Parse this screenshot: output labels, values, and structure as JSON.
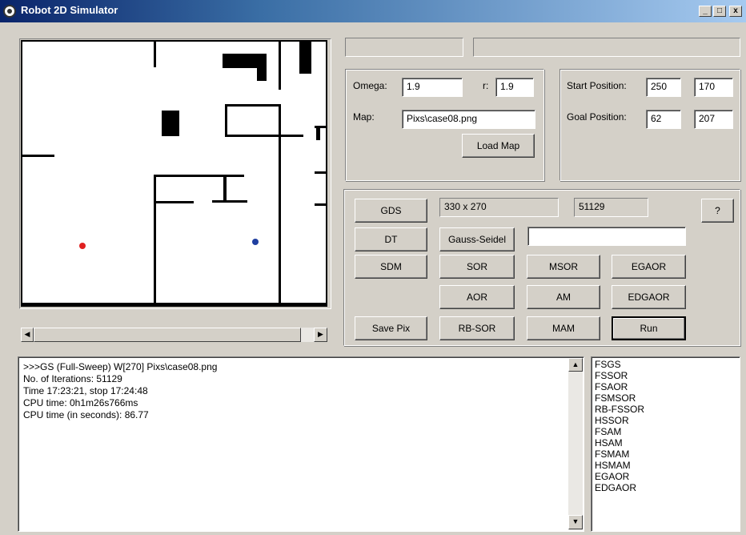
{
  "window": {
    "title": "Robot 2D Simulator",
    "minimize": "_",
    "maximize": "□",
    "close": "x"
  },
  "params": {
    "omega_label": "Omega:",
    "omega_value": "1.9",
    "r_label": "r:",
    "r_value": "1.9",
    "map_label": "Map:",
    "map_value": "Pixs\\case08.png",
    "load_map": "Load Map"
  },
  "positions": {
    "start_label": "Start Position:",
    "start_x": "250",
    "start_y": "170",
    "goal_label": "Goal Position:",
    "goal_x": "62",
    "goal_y": "207"
  },
  "status": {
    "size": "330 x 270",
    "iterations": "51129",
    "method": "Gauss-Seidel",
    "method_value": ""
  },
  "buttons": {
    "gds": "GDS",
    "help": "?",
    "dt": "DT",
    "sdm": "SDM",
    "sor": "SOR",
    "msor": "MSOR",
    "egaor": "EGAOR",
    "aor": "AOR",
    "am": "AM",
    "edgaor": "EDGAOR",
    "save_pix": "Save Pix",
    "rb_sor": "RB-SOR",
    "mam": "MAM",
    "run": "Run"
  },
  "log": {
    "lines": [
      ">>>GS (Full-Sweep) W[270] Pixs\\case08.png",
      "No. of Iterations: 51129",
      "Time 17:23:21, stop 17:24:48",
      "CPU time: 0h1m26s766ms",
      "CPU time (in seconds): 86.77"
    ]
  },
  "methods_list": [
    "FSGS",
    "FSSOR",
    "FSAOR",
    "FSMSOR",
    "RB-FSSOR",
    "HSSOR",
    "FSAM",
    "HSAM",
    "FSMAM",
    "HSMAM",
    "EGAOR",
    "EDGAOR"
  ],
  "colors": {
    "start_dot": "#e02020",
    "goal_dot": "#1f3fa0"
  }
}
